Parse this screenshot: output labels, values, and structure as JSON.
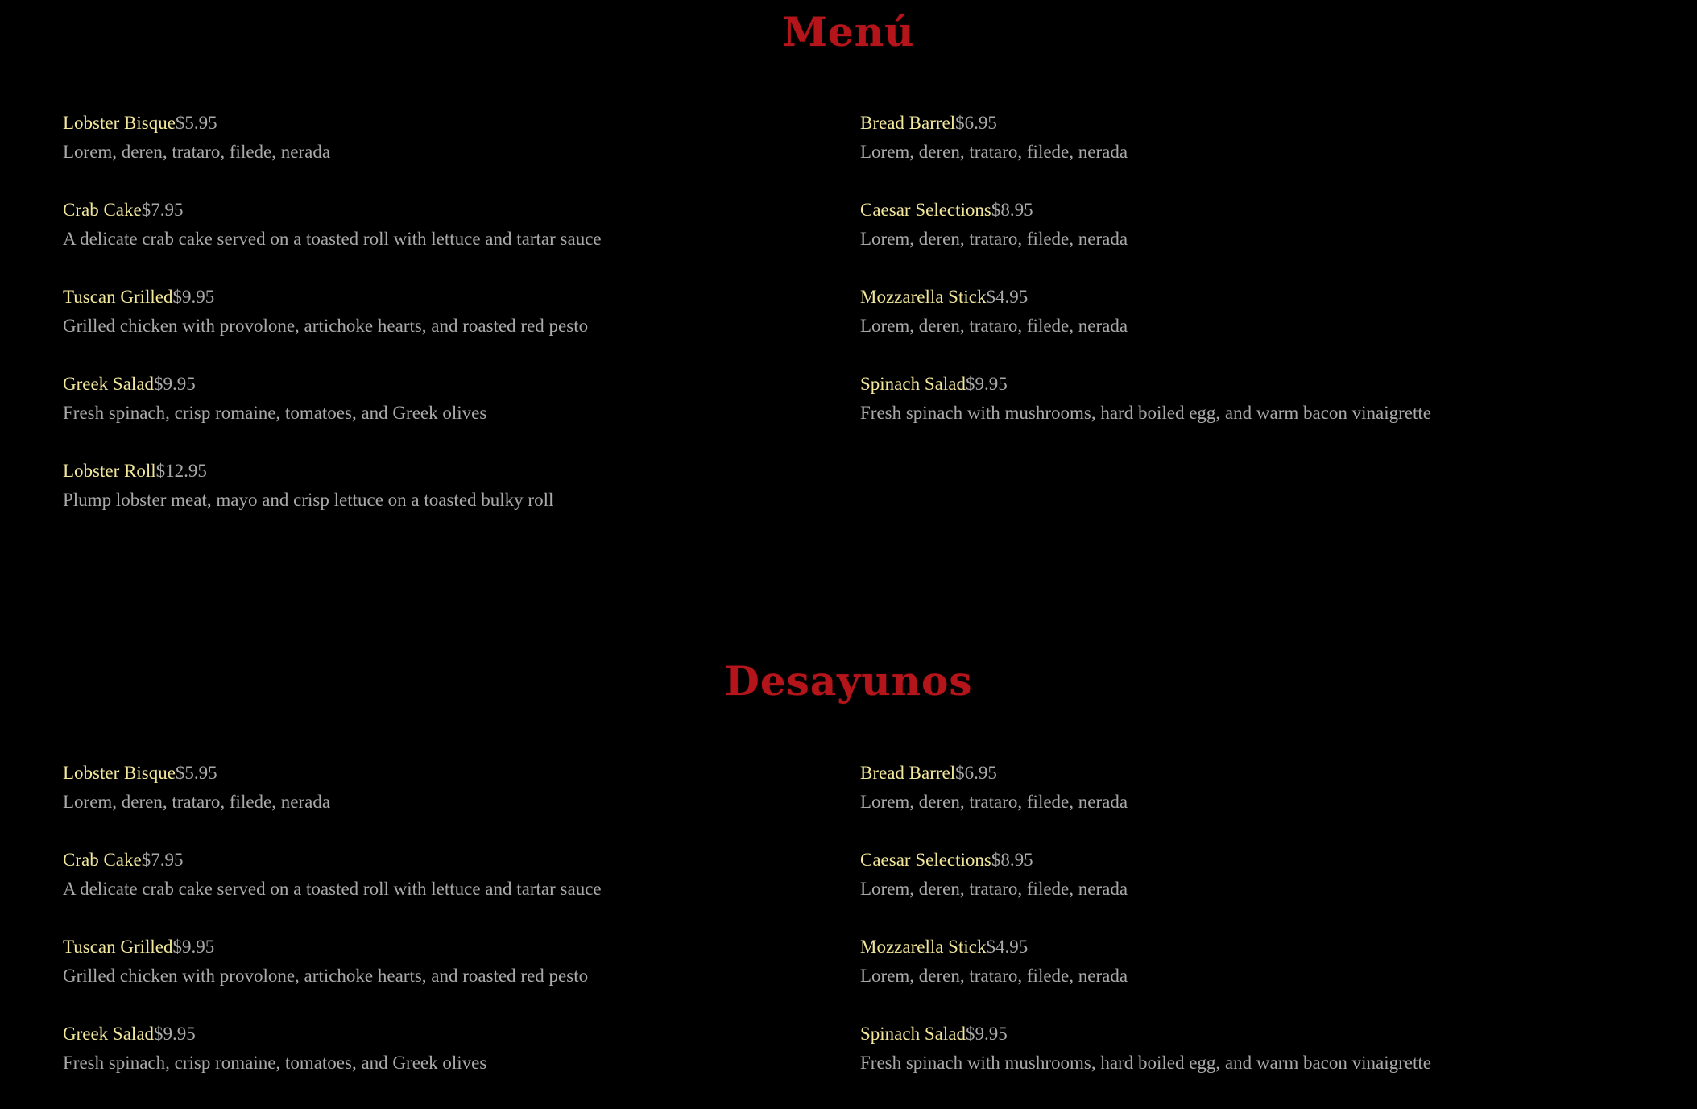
{
  "sections": [
    {
      "title": "Menú",
      "left_items": [
        {
          "name": "Lobster Bisque",
          "price": "$5.95",
          "description": "Lorem, deren, trataro, filede, nerada"
        },
        {
          "name": "Crab Cake",
          "price": "$7.95",
          "description": "A delicate crab cake served on a toasted roll with lettuce and tartar sauce"
        },
        {
          "name": "Tuscan Grilled",
          "price": "$9.95",
          "description": "Grilled chicken with provolone, artichoke hearts, and roasted red pesto"
        },
        {
          "name": "Greek Salad",
          "price": "$9.95",
          "description": "Fresh spinach, crisp romaine, tomatoes, and Greek olives"
        },
        {
          "name": "Lobster Roll",
          "price": "$12.95",
          "description": "Plump lobster meat, mayo and crisp lettuce on a toasted bulky roll"
        }
      ],
      "right_items": [
        {
          "name": "Bread Barrel",
          "price": "$6.95",
          "description": "Lorem, deren, trataro, filede, nerada"
        },
        {
          "name": "Caesar Selections",
          "price": "$8.95",
          "description": "Lorem, deren, trataro, filede, nerada"
        },
        {
          "name": "Mozzarella Stick",
          "price": "$4.95",
          "description": "Lorem, deren, trataro, filede, nerada"
        },
        {
          "name": "Spinach Salad",
          "price": "$9.95",
          "description": "Fresh spinach with mushrooms, hard boiled egg, and warm bacon vinaigrette"
        }
      ]
    },
    {
      "title": "Desayunos",
      "left_items": [
        {
          "name": "Lobster Bisque",
          "price": "$5.95",
          "description": "Lorem, deren, trataro, filede, nerada"
        },
        {
          "name": "Crab Cake",
          "price": "$7.95",
          "description": "A delicate crab cake served on a toasted roll with lettuce and tartar sauce"
        },
        {
          "name": "Tuscan Grilled",
          "price": "$9.95",
          "description": "Grilled chicken with provolone, artichoke hearts, and roasted red pesto"
        },
        {
          "name": "Greek Salad",
          "price": "$9.95",
          "description": "Fresh spinach, crisp romaine, tomatoes, and Greek olives"
        }
      ],
      "right_items": [
        {
          "name": "Bread Barrel",
          "price": "$6.95",
          "description": "Lorem, deren, trataro, filede, nerada"
        },
        {
          "name": "Caesar Selections",
          "price": "$8.95",
          "description": "Lorem, deren, trataro, filede, nerada"
        },
        {
          "name": "Mozzarella Stick",
          "price": "$4.95",
          "description": "Lorem, deren, trataro, filede, nerada"
        },
        {
          "name": "Spinach Salad",
          "price": "$9.95",
          "description": "Fresh spinach with mushrooms, hard boiled egg, and warm bacon vinaigrette"
        }
      ]
    }
  ],
  "colors": {
    "background": "#000000",
    "title": "#b3151a",
    "item_name": "#f2e79a",
    "price_and_description": "#a9a9a9"
  }
}
